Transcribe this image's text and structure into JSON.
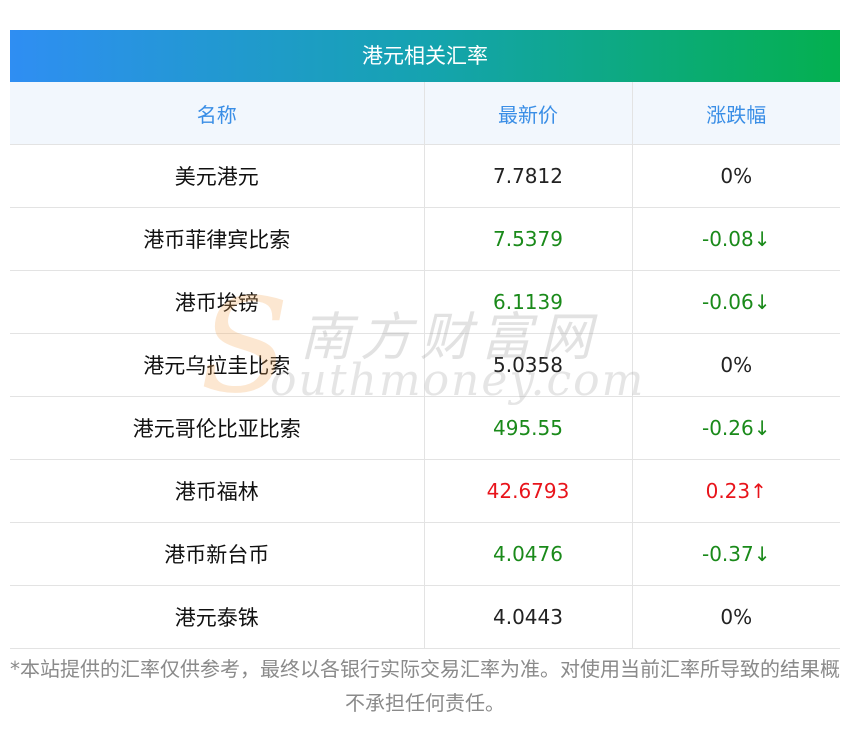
{
  "title": "港元相关汇率",
  "columns": [
    "名称",
    "最新价",
    "涨跌幅"
  ],
  "rows": [
    {
      "name": "美元港元",
      "price": "7.7812",
      "change": "0%",
      "trend": "flat"
    },
    {
      "name": "港币菲律宾比索",
      "price": "7.5379",
      "change": "-0.08↓",
      "trend": "down"
    },
    {
      "name": "港币埃镑",
      "price": "6.1139",
      "change": "-0.06↓",
      "trend": "down"
    },
    {
      "name": "港元乌拉圭比索",
      "price": "5.0358",
      "change": "0%",
      "trend": "flat"
    },
    {
      "name": "港元哥伦比亚比索",
      "price": "495.55",
      "change": "-0.26↓",
      "trend": "down"
    },
    {
      "name": "港币福林",
      "price": "42.6793",
      "change": "0.23↑",
      "trend": "up"
    },
    {
      "name": "港币新台币",
      "price": "4.0476",
      "change": "-0.37↓",
      "trend": "down"
    },
    {
      "name": "港元泰铢",
      "price": "4.0443",
      "change": "0%",
      "trend": "flat"
    }
  ],
  "watermark": {
    "cn": "南方财富网",
    "en": "outhmoney.com",
    "s": "S"
  },
  "footnote": "*本站提供的汇率仅供参考，最终以各银行实际交易汇率为准。对使用当前汇率所导致的结果概不承担任何责任。",
  "colors": {
    "up": "#e8141b",
    "down": "#1a8a1a",
    "header_text": "#3a8ee6"
  }
}
